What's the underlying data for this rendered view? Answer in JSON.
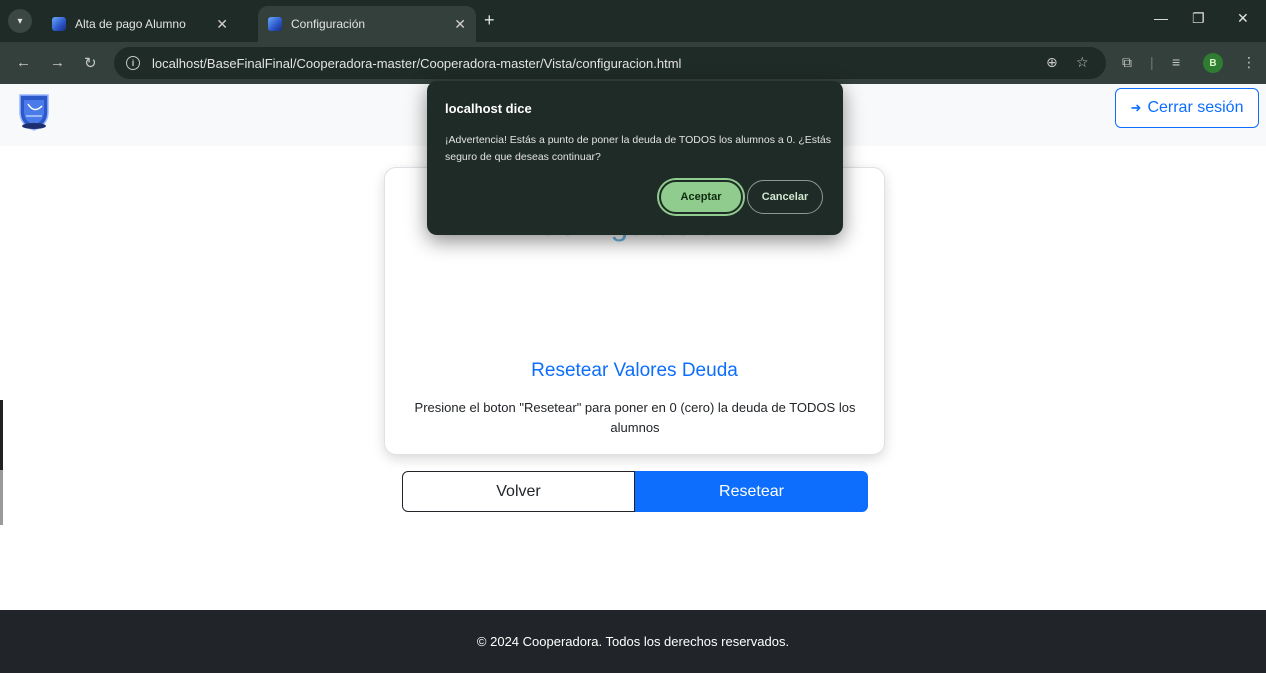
{
  "browser": {
    "tabs": [
      {
        "title": "Alta de pago Alumno",
        "active": false
      },
      {
        "title": "Configuración",
        "active": true
      }
    ],
    "url": "localhost/BaseFinalFinal/Cooperadora-master/Cooperadora-master/Vista/configuracion.html",
    "profile_initial": "B",
    "icons": {
      "tab_menu": "chevron-down-icon",
      "close": "close-icon",
      "new_tab": "plus-icon",
      "minimize": "minimize-icon",
      "restore": "restore-icon",
      "window_close": "window-close-icon",
      "back": "arrow-left-icon",
      "forward": "arrow-right-icon",
      "reload": "reload-icon",
      "site_info": "info-icon",
      "zoom": "zoom-icon",
      "bookmark": "star-icon",
      "extensions": "puzzle-icon",
      "media": "media-queue-icon",
      "menu": "kebab-menu-icon"
    }
  },
  "navbar": {
    "logout_label": "Cerrar sesión",
    "logout_icon": "sign-out-icon"
  },
  "card": {
    "title": "Configuración",
    "section_title": "Resetear Valores Deuda",
    "description": "Presione el boton \"Resetear\" para poner en 0 (cero) la deuda de TODOS los alumnos",
    "back_label": "Volver",
    "reset_label": "Resetear"
  },
  "footer": {
    "text": "© 2024 Cooperadora. Todos los derechos reservados."
  },
  "dialog": {
    "title": "localhost dice",
    "message": "¡Advertencia! Estás a punto de poner la deuda de TODOS los alumnos a 0. ¿Estás seguro de que deseas continuar?",
    "ok_label": "Aceptar",
    "cancel_label": "Cancelar"
  },
  "colors": {
    "chrome_dark": "#1f2b26",
    "chrome_toolbar": "#33403b",
    "primary": "#0d6efd",
    "card_title": "#6bb8e4",
    "footer_bg": "#212529",
    "dialog_ok": "#8fcc8d"
  }
}
